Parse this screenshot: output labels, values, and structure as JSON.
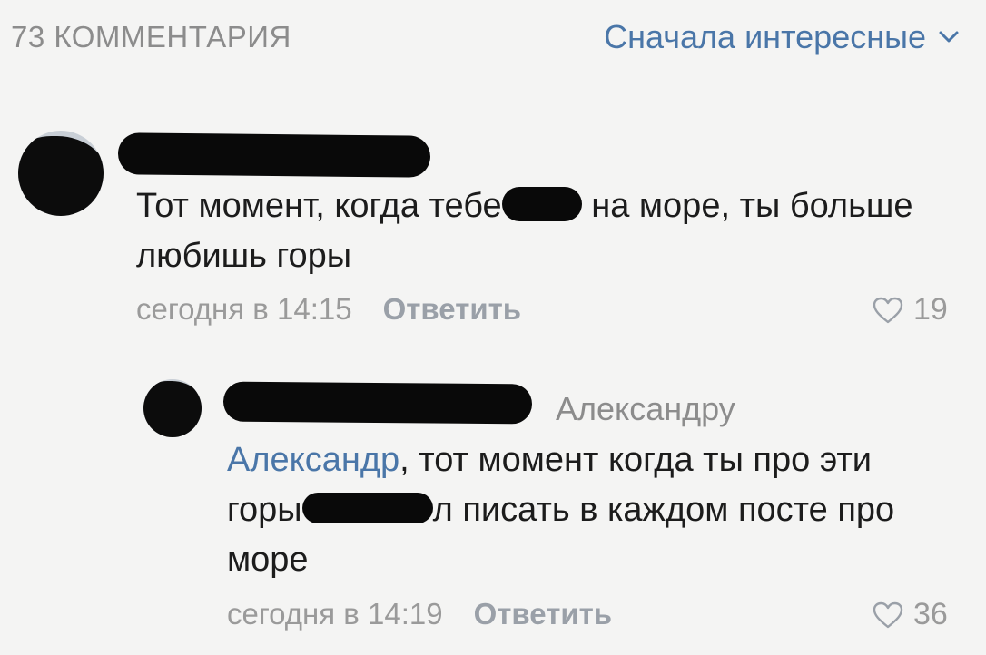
{
  "header": {
    "count_label": "73 КОММЕНТАРИЯ",
    "sort_label": "Сначала интересные",
    "sort_icon": "chevron-down-icon"
  },
  "comments": [
    {
      "text_before": "Тот момент, когда тебе",
      "text_after": " на море, ты больше любишь горы",
      "time": "сегодня в 14:15",
      "reply_label": "Ответить",
      "likes": "19",
      "like_icon": "heart-icon"
    },
    {
      "reply_to": "Александру",
      "mention": "Александр",
      "text_part1": ", тот момент когда ты про эти горы",
      "text_part2": "л писать в каждом посте про море",
      "time": "сегодня в 14:19",
      "reply_label": "Ответить",
      "likes": "36",
      "like_icon": "heart-icon"
    }
  ],
  "colors": {
    "link": "#4a76a8",
    "muted": "#8c8c8c",
    "background": "#f4f4f3"
  }
}
